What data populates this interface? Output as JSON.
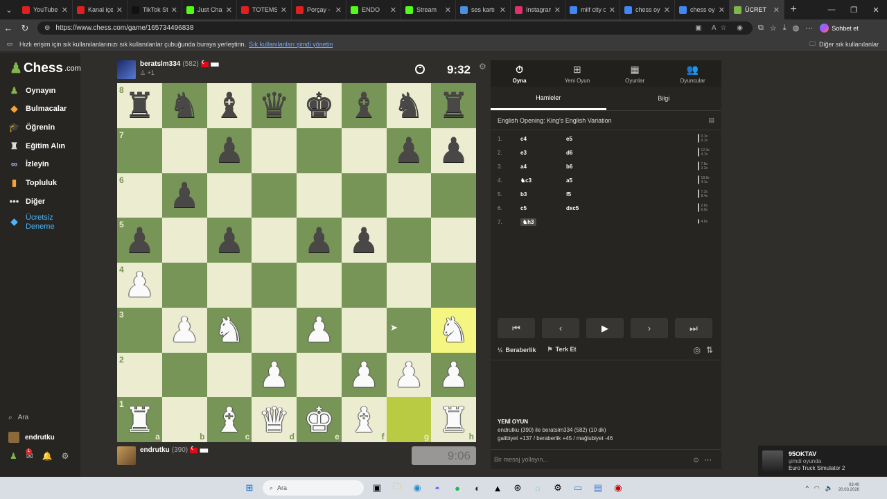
{
  "browser": {
    "tabs": [
      {
        "label": "YouTube",
        "color": "#e02020"
      },
      {
        "label": "Kanal içeriği",
        "color": "#e02020"
      },
      {
        "label": "TikTok Studi",
        "color": "#111111"
      },
      {
        "label": "Just Chattin",
        "color": "#53fc18"
      },
      {
        "label": "TOTEMSİZ",
        "color": "#e02020"
      },
      {
        "label": "Porçay - Ö",
        "color": "#e02020"
      },
      {
        "label": "ENDO",
        "color": "#53fc18"
      },
      {
        "label": "Stream",
        "color": "#53fc18"
      },
      {
        "label": "ses kartı - C",
        "color": "#4a90e2"
      },
      {
        "label": "Instagram",
        "color": "#e1306c"
      },
      {
        "label": "milf city oy",
        "color": "#4285f4"
      },
      {
        "label": "chess oyna",
        "color": "#4285f4"
      },
      {
        "label": "chess oyna",
        "color": "#4285f4"
      },
      {
        "label": "ÜCRET",
        "color": "#81b64c",
        "active": true
      }
    ],
    "url": "https://www.chess.com/game/165734496838",
    "copilot_label": "Sohbet et",
    "bookmark_text": "Hızlı erişim için sık kullanılanlarınızı sık kullanılanlar çubuğunda buraya yerleştirin.",
    "bookmark_link": "Sık kullanılanları şimdi yönetin",
    "other_bookmarks": "Diğer sık kullanılanlar"
  },
  "sidebar": {
    "logo": "Chess",
    "logo_suffix": ".com",
    "items": [
      {
        "label": "Oynayın",
        "icon": "pawn-icon",
        "color": "#81b64c"
      },
      {
        "label": "Bulmacalar",
        "icon": "puzzle-icon",
        "color": "#f7a33b"
      },
      {
        "label": "Öğrenin",
        "icon": "learn-icon",
        "color": "#4db5f7"
      },
      {
        "label": "Eğitim Alın",
        "icon": "coach-icon",
        "color": "#dddddd"
      },
      {
        "label": "İzleyin",
        "icon": "binoculars-icon",
        "color": "#9fb8ff"
      },
      {
        "label": "Topluluk",
        "icon": "community-icon",
        "color": "#f7a33b"
      },
      {
        "label": "Diğer",
        "icon": "more-icon",
        "color": "#dddddd"
      },
      {
        "label_1": "Ücretsiz",
        "label_2": "Deneme",
        "icon": "diamond-icon",
        "color": "#4db5f7"
      }
    ],
    "search": "Ara",
    "username": "endrutku",
    "mail_badge": "1"
  },
  "game": {
    "top_player": {
      "name": "beratslm334",
      "rating": "(582)",
      "sub": "+1",
      "clock": "9:32"
    },
    "bottom_player": {
      "name": "endrutku",
      "rating": "(390)",
      "clock": "9:06"
    },
    "board": [
      [
        "bR",
        "bN",
        "bB",
        "bQ",
        "bK",
        "bB",
        "bN",
        "bR"
      ],
      [
        "",
        "",
        "bP",
        "",
        "",
        "",
        "bP",
        "bP"
      ],
      [
        "",
        "bP",
        "",
        "",
        "",
        "",
        "",
        ""
      ],
      [
        "bP",
        "",
        "bP",
        "",
        "bP",
        "bP",
        "",
        ""
      ],
      [
        "wP",
        "",
        "",
        "",
        "",
        "",
        "",
        ""
      ],
      [
        "",
        "wP",
        "wN",
        "",
        "wP",
        "",
        "",
        "wN"
      ],
      [
        "",
        "",
        "",
        "wP",
        "",
        "wP",
        "wP",
        "wP"
      ],
      [
        "wR",
        "",
        "wB",
        "wQ",
        "wK",
        "wB",
        "",
        "wR"
      ]
    ],
    "highlights": [
      "g1",
      "h3"
    ],
    "files": [
      "a",
      "b",
      "c",
      "d",
      "e",
      "f",
      "g",
      "h"
    ],
    "ranks": [
      "8",
      "7",
      "6",
      "5",
      "4",
      "3",
      "2",
      "1"
    ]
  },
  "panel": {
    "tabs": [
      {
        "label": "Oyna",
        "icon": "stopwatch-icon",
        "active": true
      },
      {
        "label": "Yeni Oyun",
        "icon": "plus-icon"
      },
      {
        "label": "Oyunlar",
        "icon": "board-icon"
      },
      {
        "label": "Oyuncular",
        "icon": "players-icon"
      }
    ],
    "subtabs": [
      "Hamleler",
      "Bilgi"
    ],
    "opening": "English Opening: King's English Variation",
    "moves": [
      {
        "num": "1.",
        "white": "c4",
        "black": "e5",
        "wt": "0.1s",
        "bt": "0.1s"
      },
      {
        "num": "2.",
        "white": "e3",
        "black": "d6",
        "wt": "12.3s",
        "bt": "4.7s"
      },
      {
        "num": "3.",
        "white": "a4",
        "black": "b6",
        "wt": "7.8s",
        "bt": "2.2s"
      },
      {
        "num": "4.",
        "white": "♞c3",
        "black": "a5",
        "wt": "18.8s",
        "bt": "4.1s"
      },
      {
        "num": "5.",
        "white": "b3",
        "black": "f5",
        "wt": "7.3s",
        "bt": "8.4s"
      },
      {
        "num": "6.",
        "white": "c5",
        "black": "dxc5",
        "wt": "2.6s",
        "bt": "6.0s"
      },
      {
        "num": "7.",
        "white": "♞h3",
        "black": "",
        "wt": "4.6s",
        "bt": ""
      }
    ],
    "draw_label": "Beraberlik",
    "resign_label": "Terk Et",
    "chat_title": "YENİ OYUN",
    "chat_line1": "endrutku (390) ile beratslm334 (582) (10 dk)",
    "chat_line2": "galibiyet +137 / beraberlik +45 / mağlubiyet -46",
    "message_placeholder": "Bir mesaj yollayın..."
  },
  "notification": {
    "name": "95OKTAV",
    "status": "şimdi oyunda",
    "game": "Euro Truck Simulator 2"
  },
  "taskbar": {
    "search": "Ara",
    "time": "03:40",
    "date": "20.03.2026"
  }
}
